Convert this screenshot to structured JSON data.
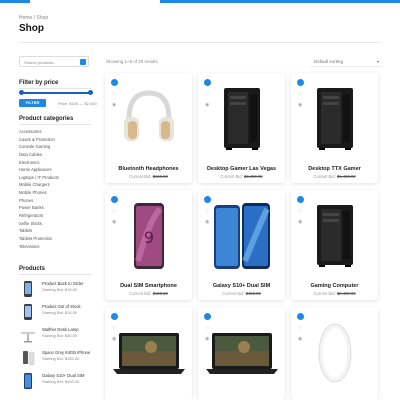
{
  "breadcrumb": "Home / Shop",
  "page_title": "Shop",
  "search": {
    "placeholder": "Search products..."
  },
  "price_filter": {
    "heading": "Filter by price",
    "button": "FILTER",
    "range_text": "Price: $100 — $2,000"
  },
  "categories": {
    "heading": "Product categories",
    "items": [
      "Accessories",
      "Cases & Protection",
      "Console Gaming",
      "Data Cables",
      "Electronics",
      "Home Appliances",
      "Laptops / IT Products",
      "Mobile Chargers",
      "Mobile Phones",
      "Phones",
      "Power Banks",
      "Refrigerators",
      "Selfie Sticks",
      "Tablets",
      "Tablets Protection",
      "Televisions"
    ]
  },
  "products_widget": {
    "heading": "Products",
    "items": [
      {
        "name": "Product Back to Order",
        "price": "Starting Bid: $15.00"
      },
      {
        "name": "Product Out of Stock",
        "price": "Starting Bid: $15.00"
      },
      {
        "name": "Walther Desk Lamp",
        "price": "Starting Bid: $45.00"
      },
      {
        "name": "Space Grey 64GB iPhone",
        "price": "Starting Bid: $150.00"
      },
      {
        "name": "Galaxy S10+ Dual SIM",
        "price": "Starting Bid: $450.00"
      }
    ]
  },
  "results_text": "Showing 1–9 of 20 results",
  "sort": {
    "selected": "Default sorting"
  },
  "grid": [
    {
      "title": "Bluetooth Headphones",
      "price_label": "Current Bid:",
      "price": "$150.00",
      "image": "headphones"
    },
    {
      "title": "Desktop Gamer Las Vegas",
      "price_label": "Current Bid:",
      "price": "$3,450.00",
      "image": "tower"
    },
    {
      "title": "Desktop TTX Gamer",
      "price_label": "Current Bid:",
      "price": "$1,450.00",
      "image": "tower"
    },
    {
      "title": "Dual SIM Smartphone",
      "price_label": "Current Bid:",
      "price": "$150.00",
      "image": "phone-pink"
    },
    {
      "title": "Galaxy S10+ Dual SIM",
      "price_label": "Current Bid:",
      "price": "$450.00",
      "image": "phone-blue"
    },
    {
      "title": "Gaming Computer",
      "price_label": "Current Bid:",
      "price": "$2,450.00",
      "image": "tower"
    },
    {
      "title": "",
      "price_label": "",
      "price": "",
      "image": "laptop"
    },
    {
      "title": "",
      "price_label": "",
      "price": "",
      "image": "laptop"
    },
    {
      "title": "",
      "price_label": "",
      "price": "",
      "image": "mouse"
    }
  ],
  "colors": {
    "accent": "#1e88e5",
    "text": "#222222",
    "muted": "#888888"
  }
}
